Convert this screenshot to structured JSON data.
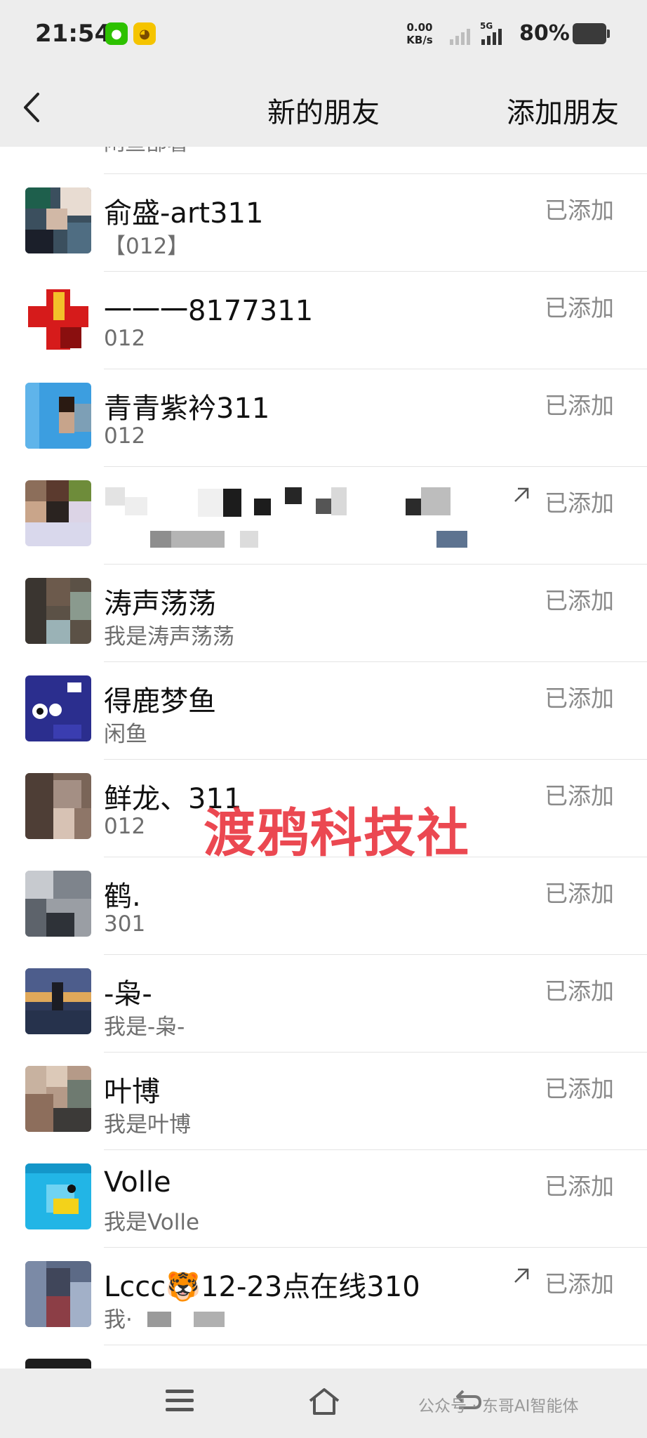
{
  "status_bar": {
    "time": "21:54",
    "net_speed_value": "0.00",
    "net_speed_unit": "KB/s",
    "network": "5G",
    "battery": "80%"
  },
  "header": {
    "title": "新的朋友",
    "add_friend": "添加朋友"
  },
  "partial_top_row": {
    "sub": "闲鱼部署"
  },
  "rows": [
    {
      "name": "俞盛-art311",
      "sub": "【012】",
      "status": "已添加"
    },
    {
      "name": "一一一8177311",
      "sub": "012",
      "status": "已添加"
    },
    {
      "name": "青青紫衿311",
      "sub": "012",
      "status": "已添加"
    },
    {
      "name": "",
      "sub": "",
      "status": "已添加"
    },
    {
      "name": "涛声荡荡",
      "sub": "我是涛声荡荡",
      "status": "已添加"
    },
    {
      "name": "得鹿梦鱼",
      "sub": "闲鱼",
      "status": "已添加"
    },
    {
      "name": "鲜龙、311",
      "sub": "012",
      "status": "已添加"
    },
    {
      "name": "鹤.",
      "sub": "301",
      "status": "已添加"
    },
    {
      "name": "-枭-",
      "sub": "我是-枭-",
      "status": "已添加"
    },
    {
      "name": "叶博",
      "sub": "我是叶博",
      "status": "已添加"
    },
    {
      "name": "Volle",
      "sub": "我是Volle",
      "status": "已添加"
    },
    {
      "name": "Lccc🐯12-23点在线310",
      "sub": "我·",
      "status": "已添加"
    }
  ],
  "watermark": "渡鸦科技社",
  "footer_credit": "公众号 · 东哥AI智能体",
  "colors": {
    "header_bg": "#ededed",
    "status_text": "#8a8a8a",
    "watermark": "#e82832"
  }
}
